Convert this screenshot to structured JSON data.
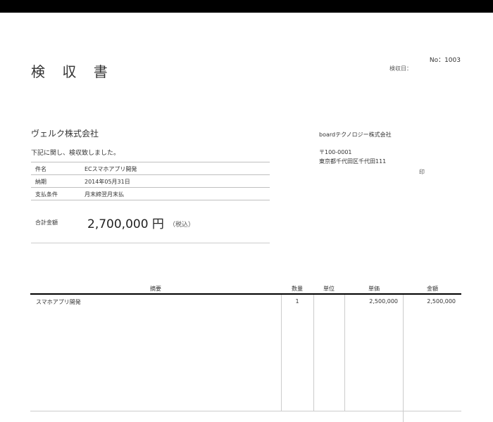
{
  "document": {
    "title": "検 収 書",
    "number": "No：1003",
    "date_label": "検収日："
  },
  "recipient": {
    "company": "ヴェルク株式会社",
    "intro": "下記に関し、検収致しました。"
  },
  "info": [
    {
      "label": "件名",
      "value": "ECスマホアプリ開発"
    },
    {
      "label": "納期",
      "value": "2014年05月31日"
    },
    {
      "label": "支払条件",
      "value": "月末締翌月末払"
    }
  ],
  "total": {
    "label": "合計金額",
    "amount": "2,700,000 円",
    "tax_note": "（税込）"
  },
  "issuer": {
    "company": "boardテクノロジー株式会社",
    "postal": "〒100-0001",
    "address": "東京都千代田区千代田111",
    "seal": "印"
  },
  "items_table": {
    "headers": [
      "摘要",
      "数量",
      "単位",
      "単価",
      "金額"
    ],
    "rows": [
      {
        "description": "スマホアプリ開発",
        "quantity": "1",
        "unit": "",
        "unit_price": "2,500,000",
        "amount": "2,500,000"
      }
    ]
  }
}
